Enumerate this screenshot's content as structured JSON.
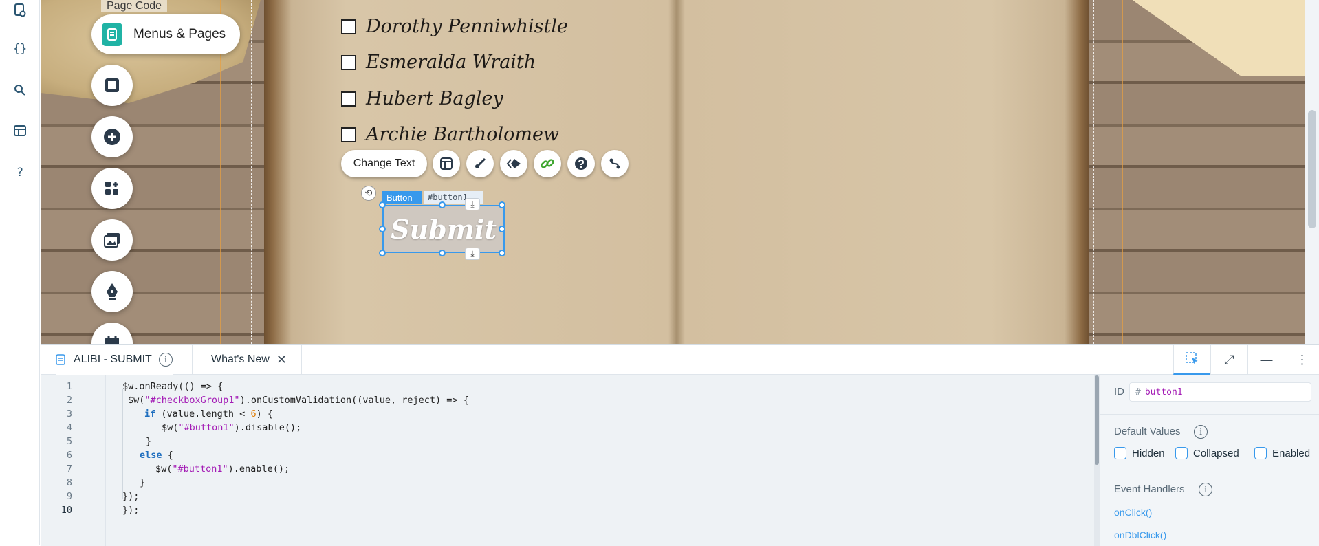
{
  "sidebar": {
    "icons": [
      "page-code-icon",
      "code-braces-icon",
      "search-icon",
      "database-icon",
      "help-icon"
    ],
    "braces": "{}",
    "help": "?"
  },
  "canvas": {
    "page_code_label": "Page Code",
    "menus_pill_label": "Menus & Pages",
    "checkbox_items": [
      "Dorothy Penniwhistle",
      "Esmeralda Wraith",
      "Hubert Bagley",
      "Archie Bartholomew"
    ],
    "toolbar": {
      "change_text_label": "Change Text"
    },
    "selection": {
      "type_label": "Button",
      "id_label": "#button1"
    },
    "submit_label": "Submit"
  },
  "tabs": {
    "file_tab_label": "ALIBI - SUBMIT",
    "whats_new_label": "What's New"
  },
  "code": {
    "line_numbers": [
      "1",
      "2",
      "3",
      "4",
      "5",
      "6",
      "7",
      "8",
      "9",
      "10"
    ],
    "current_line": 10
  },
  "properties": {
    "id_label": "ID",
    "id_value": "button1",
    "default_values_label": "Default Values",
    "checkboxes": [
      "Hidden",
      "Collapsed",
      "Enabled"
    ],
    "event_handlers_label": "Event Handlers",
    "handlers": [
      "onClick()",
      "onDblClick()"
    ]
  },
  "colors": {
    "accent": "#3899ec",
    "teal": "#20b3a5",
    "string": "#a31bb5",
    "number": "#e07b00",
    "keyword": "#1f6fbf"
  }
}
